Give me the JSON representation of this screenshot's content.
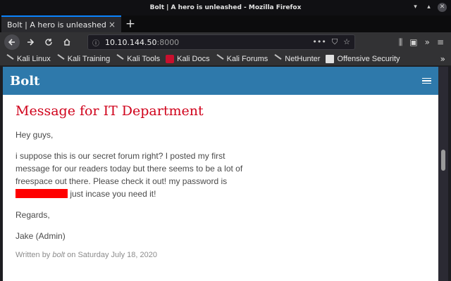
{
  "window": {
    "title": "Bolt | A hero is unleashed - Mozilla Firefox"
  },
  "tabs": [
    {
      "label": "Bolt | A hero is unleashed",
      "close": "×"
    }
  ],
  "new_tab": "+",
  "urlbar": {
    "host": "10.10.144.50",
    "port": ":8000"
  },
  "bookmarks": [
    {
      "label": "Kali Linux",
      "icon": "kali-dragon-icon"
    },
    {
      "label": "Kali Training",
      "icon": "kali-dragon-icon"
    },
    {
      "label": "Kali Tools",
      "icon": "kali-dragon-icon"
    },
    {
      "label": "Kali Docs",
      "icon": "kali-docs-icon"
    },
    {
      "label": "Kali Forums",
      "icon": "kali-dragon-icon"
    },
    {
      "label": "NetHunter",
      "icon": "kali-dragon-icon"
    },
    {
      "label": "Offensive Security",
      "icon": "offsec-icon"
    }
  ],
  "site": {
    "brand": "Bolt"
  },
  "post": {
    "title": "Message for IT Department",
    "greeting": "Hey guys,",
    "body_part1": "i suppose this is our secret forum right? I posted my first message for our readers today but there seems to be a lot of freespace out there. Please check it out! my password is",
    "body_part2": " just incase you need it!",
    "regards": "Regards,",
    "signature": "Jake (Admin)",
    "meta_prefix": "Written by ",
    "meta_author": "bolt",
    "meta_suffix": " on Saturday July 18, 2020"
  },
  "colors": {
    "header": "#2e79ab",
    "title": "#d0021b",
    "redaction": "#ff0000"
  }
}
